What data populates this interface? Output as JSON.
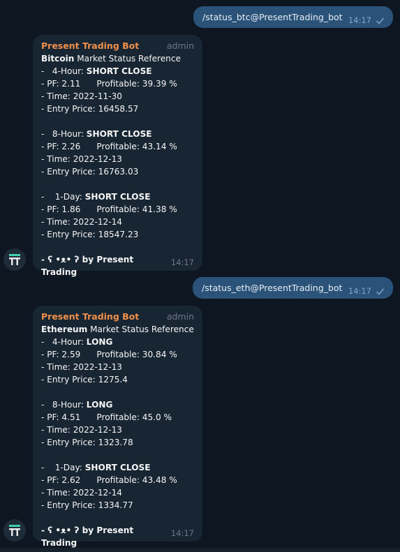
{
  "messages": [
    {
      "type": "out",
      "text": "/status_btc@PresentTrading_bot",
      "time": "14:17"
    },
    {
      "type": "in",
      "sender": "Present Trading Bot",
      "role": "admin",
      "coin": "Bitcoin",
      "title_suffix": " Market Status Reference",
      "blocks": [
        {
          "label_prefix": "-   4-Hour: ",
          "signal": "SHORT CLOSE",
          "pf_line": "- PF: 2.11      Profitable: 39.39 %",
          "time_line": "- Time: 2022-11-30",
          "entry_line": "- Entry Price: 16458.57"
        },
        {
          "label_prefix": "-   8-Hour: ",
          "signal": "SHORT CLOSE",
          "pf_line": "- PF: 2.26      Profitable: 43.14 %",
          "time_line": "- Time: 2022-12-13",
          "entry_line": "- Entry Price: 16763.03"
        },
        {
          "label_prefix": "-    1-Day: ",
          "signal": "SHORT CLOSE",
          "pf_line": "- PF: 1.86      Profitable: 41.38 %",
          "time_line": "- Time: 2022-12-14",
          "entry_line": "- Entry Price: 18547.23"
        }
      ],
      "footer": "- ʕ •ᴥ• ʔ by Present Trading",
      "time": "14:17"
    },
    {
      "type": "out",
      "text": "/status_eth@PresentTrading_bot",
      "time": "14:17"
    },
    {
      "type": "in",
      "sender": "Present Trading Bot",
      "role": "admin",
      "coin": "Ethereum",
      "title_suffix": " Market Status Reference",
      "blocks": [
        {
          "label_prefix": "-   4-Hour: ",
          "signal": "LONG",
          "pf_line": "- PF: 2.59      Profitable: 30.84 %",
          "time_line": "- Time: 2022-12-13",
          "entry_line": "- Entry Price: 1275.4"
        },
        {
          "label_prefix": "-   8-Hour: ",
          "signal": "LONG",
          "pf_line": "- PF: 4.51      Profitable: 45.0 %",
          "time_line": "- Time: 2022-12-13",
          "entry_line": "- Entry Price: 1323.78"
        },
        {
          "label_prefix": "-    1-Day: ",
          "signal": "SHORT CLOSE",
          "pf_line": "- PF: 2.62      Profitable: 43.48 %",
          "time_line": "- Time: 2022-12-14",
          "entry_line": "- Entry Price: 1334.77"
        }
      ],
      "footer": "- ʕ •ᴥ• ʔ by Present Trading",
      "time": "14:17"
    }
  ],
  "colors": {
    "background": "#0e1621",
    "outgoing_bubble": "#2b5278",
    "incoming_bubble": "#182533",
    "sender_name": "#f0904a",
    "muted": "#6c7883",
    "check": "#7da8d3"
  },
  "icons": {
    "read_status": "check-icon",
    "bot_avatar": "present-trading-logo-icon"
  }
}
